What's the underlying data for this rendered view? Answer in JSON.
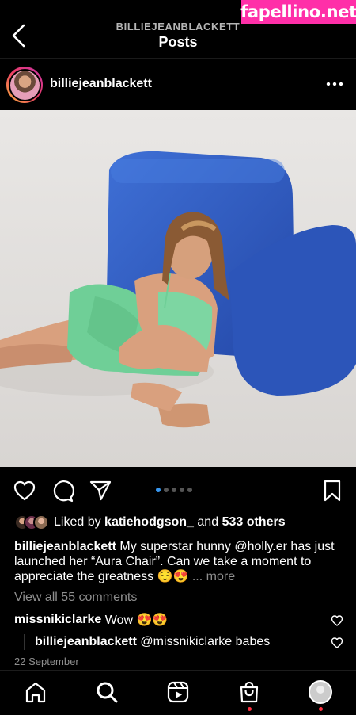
{
  "watermark": "fapellino.net",
  "header": {
    "username": "BILLIEJEANBLACKETT",
    "title": "Posts"
  },
  "post": {
    "author": "billiejeanblackett",
    "carousel": {
      "count": 5,
      "active_index": 0
    },
    "likes": {
      "prefix": "Liked by",
      "user": "katiehodgson_",
      "middle": "and",
      "others": "533 others"
    },
    "caption": {
      "author": "billiejeanblackett",
      "text": "My superstar hunny @holly.er has just launched her “Aura Chair”. Can we take a moment to appreciate the greatness 😌😍",
      "more": "... more"
    },
    "view_comments": "View all 55 comments",
    "comments": [
      {
        "author": "missnikiclarke",
        "text": "Wow 😍😍"
      },
      {
        "author": "billiejeanblackett",
        "text": "@missnikiclarke babes"
      }
    ],
    "date": "22 September"
  },
  "colors": {
    "accent": "#3897f0",
    "watermark": "#ff2fa8",
    "notification": "#ff3040",
    "chair": "#2f5fc4",
    "dress": "#6fcf97"
  }
}
